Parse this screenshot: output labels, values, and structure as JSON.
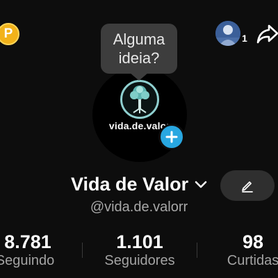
{
  "top_bar": {
    "coin_letter": "P",
    "friends_count": "1",
    "icons": [
      "coin-icon",
      "friends-avatar",
      "share-icon"
    ]
  },
  "tooltip": {
    "text": "Alguma\nideia?"
  },
  "avatar": {
    "brand_text": "vida.de.valor",
    "add_icon": "plus-icon"
  },
  "profile": {
    "display_name": "Vida de Valor",
    "username": "@vida.de.valorr",
    "name_dropdown_icon": "chevron-down-icon",
    "edit_icon": "pencil-icon"
  },
  "stats": [
    {
      "value": "8.781",
      "label": "Seguindo"
    },
    {
      "value": "1.101",
      "label": "Seguidores"
    },
    {
      "value": "98",
      "label": "Curtidas"
    }
  ],
  "colors": {
    "background": "#0d0d0d",
    "coin": "#f2b21a",
    "add_button": "#28a7e1",
    "bubble": "#3d3d3d",
    "muted_text": "#a3a3a3"
  }
}
